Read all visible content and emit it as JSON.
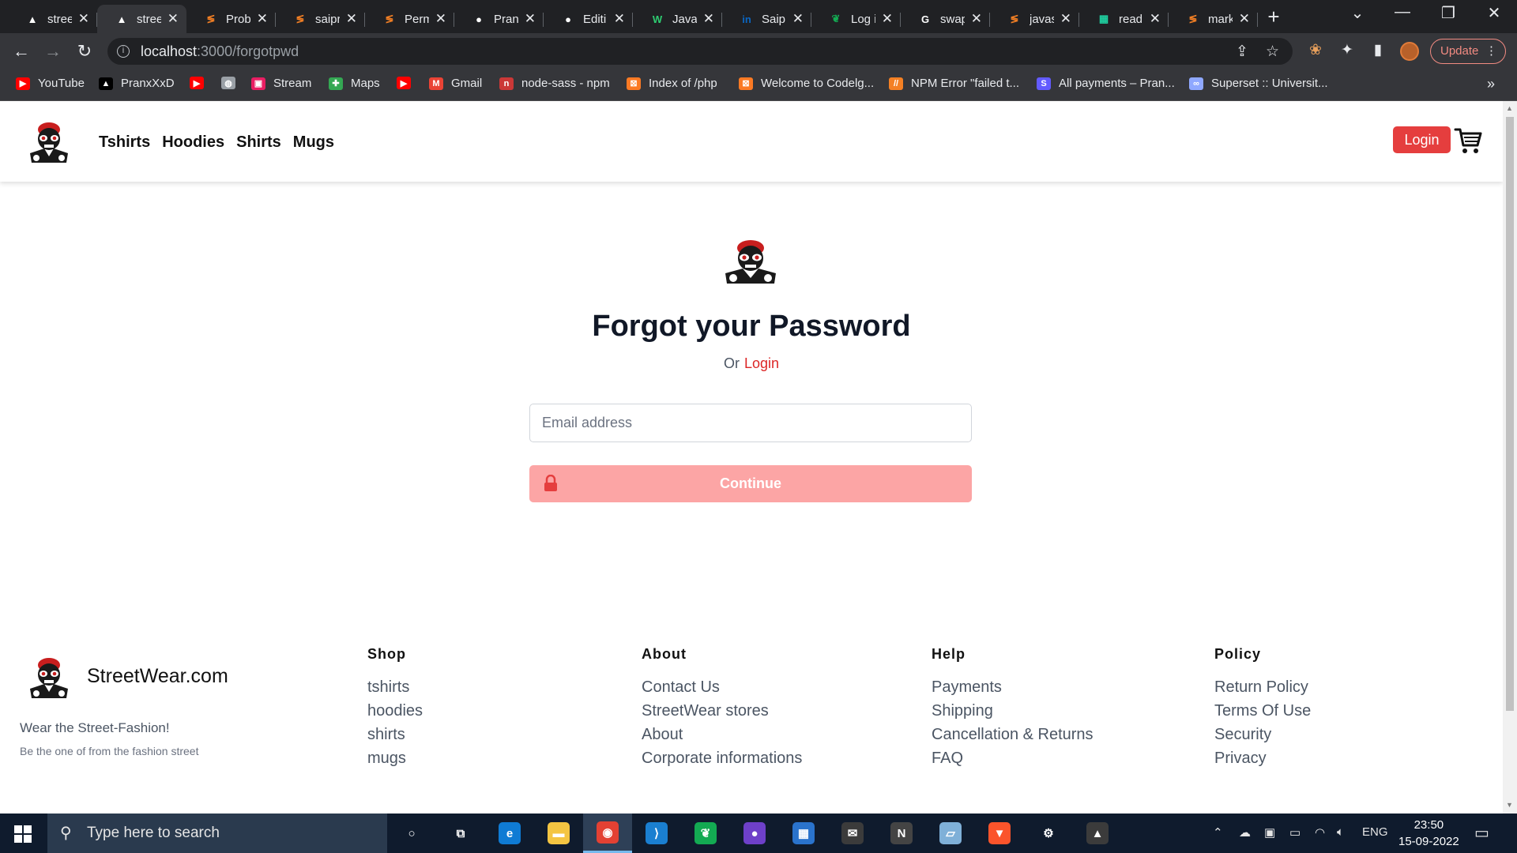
{
  "browser": {
    "tabs": [
      {
        "title": "stree",
        "icon": "vercel-icon",
        "color": "#ffffff"
      },
      {
        "title": "stree",
        "icon": "vercel-icon",
        "color": "#ffffff",
        "active": true
      },
      {
        "title": "Prob",
        "icon": "stackoverflow-icon",
        "color": "#f48024"
      },
      {
        "title": "saipr",
        "icon": "stackoverflow-icon",
        "color": "#f48024"
      },
      {
        "title": "Perm",
        "icon": "stackoverflow-icon",
        "color": "#f48024"
      },
      {
        "title": "Pran",
        "icon": "github-icon",
        "color": "#ffffff"
      },
      {
        "title": "Editi",
        "icon": "github-icon",
        "color": "#ffffff"
      },
      {
        "title": "Java!",
        "icon": "w-icon",
        "color": "#2ecc71"
      },
      {
        "title": "Saipr",
        "icon": "linkedin-icon",
        "color": "#0a66c2"
      },
      {
        "title": "Log i",
        "icon": "mongodb-icon",
        "color": "#13aa52"
      },
      {
        "title": "swap",
        "icon": "google-icon",
        "color": "#ffffff"
      },
      {
        "title": "javas",
        "icon": "stackoverflow-icon",
        "color": "#f48024"
      },
      {
        "title": "read",
        "icon": "sheet-icon",
        "color": "#1fd1a1"
      },
      {
        "title": "mark",
        "icon": "stackoverflow-icon",
        "color": "#f48024"
      }
    ],
    "url_host": "localhost",
    "url_path": ":3000/forgotpwd",
    "update_label": "Update",
    "bookmarks": [
      {
        "label": "YouTube",
        "icon": "youtube-icon",
        "color": "#ff0000"
      },
      {
        "label": "PranxXxD",
        "icon": "vercel-icon",
        "color": "#000000"
      },
      {
        "label": "",
        "icon": "youtube-icon",
        "color": "#ff0000"
      },
      {
        "label": "",
        "icon": "globe-icon",
        "color": "#9aa0a6"
      },
      {
        "label": "Stream",
        "icon": "stream-icon",
        "color": "#e91e63"
      },
      {
        "label": "Maps",
        "icon": "maps-icon",
        "color": "#34a853"
      },
      {
        "label": "",
        "icon": "youtube-icon",
        "color": "#ff0000"
      },
      {
        "label": "Gmail",
        "icon": "gmail-icon",
        "color": "#ea4335"
      },
      {
        "label": "node-sass - npm",
        "icon": "npm-icon",
        "color": "#cb3837"
      },
      {
        "label": "Index of /php",
        "icon": "xampp-icon",
        "color": "#fb7a24"
      },
      {
        "label": "Welcome to Codelg...",
        "icon": "xampp-icon",
        "color": "#fb7a24"
      },
      {
        "label": "NPM Error \"failed t...",
        "icon": "slashes-icon",
        "color": "#f48024"
      },
      {
        "label": "All payments – Pran...",
        "icon": "stripe-icon",
        "color": "#635bff"
      },
      {
        "label": "Superset :: Universit...",
        "icon": "superset-icon",
        "color": "#8fa8ff"
      }
    ]
  },
  "site": {
    "nav_links": [
      "Tshirts",
      "Hoodies",
      "Shirts",
      "Mugs"
    ],
    "login_label": "Login",
    "heading": "Forgot your Password",
    "or_text": "Or",
    "or_link": "Login",
    "email_placeholder": "Email address",
    "continue_label": "Continue",
    "accent_color": "#e53e3e",
    "footer": {
      "brand": "StreetWear.com",
      "tagline": "Wear the Street-Fashion!",
      "subtagline": "Be the one of from the fashion street",
      "columns": [
        {
          "heading": "Shop",
          "items": [
            "tshirts",
            "hoodies",
            "shirts",
            "mugs"
          ]
        },
        {
          "heading": "About",
          "items": [
            "Contact Us",
            "StreetWear stores",
            "About",
            "Corporate informations"
          ]
        },
        {
          "heading": "Help",
          "items": [
            "Payments",
            "Shipping",
            "Cancellation & Returns",
            "FAQ"
          ]
        },
        {
          "heading": "Policy",
          "items": [
            "Return Policy",
            "Terms Of Use",
            "Security",
            "Privacy"
          ]
        }
      ]
    }
  },
  "taskbar": {
    "search_placeholder": "Type here to search",
    "apps": [
      "cortana-icon",
      "task-view-icon",
      "edge-icon",
      "file-explorer-icon",
      "chrome-icon",
      "vscode-icon",
      "mongodb-compass-icon",
      "github-desktop-icon",
      "store-icon",
      "mail-icon",
      "notion-icon",
      "notepad-icon",
      "brave-icon",
      "settings-icon",
      "photos-icon"
    ],
    "language": "ENG",
    "time": "23:50",
    "date": "15-09-2022"
  }
}
